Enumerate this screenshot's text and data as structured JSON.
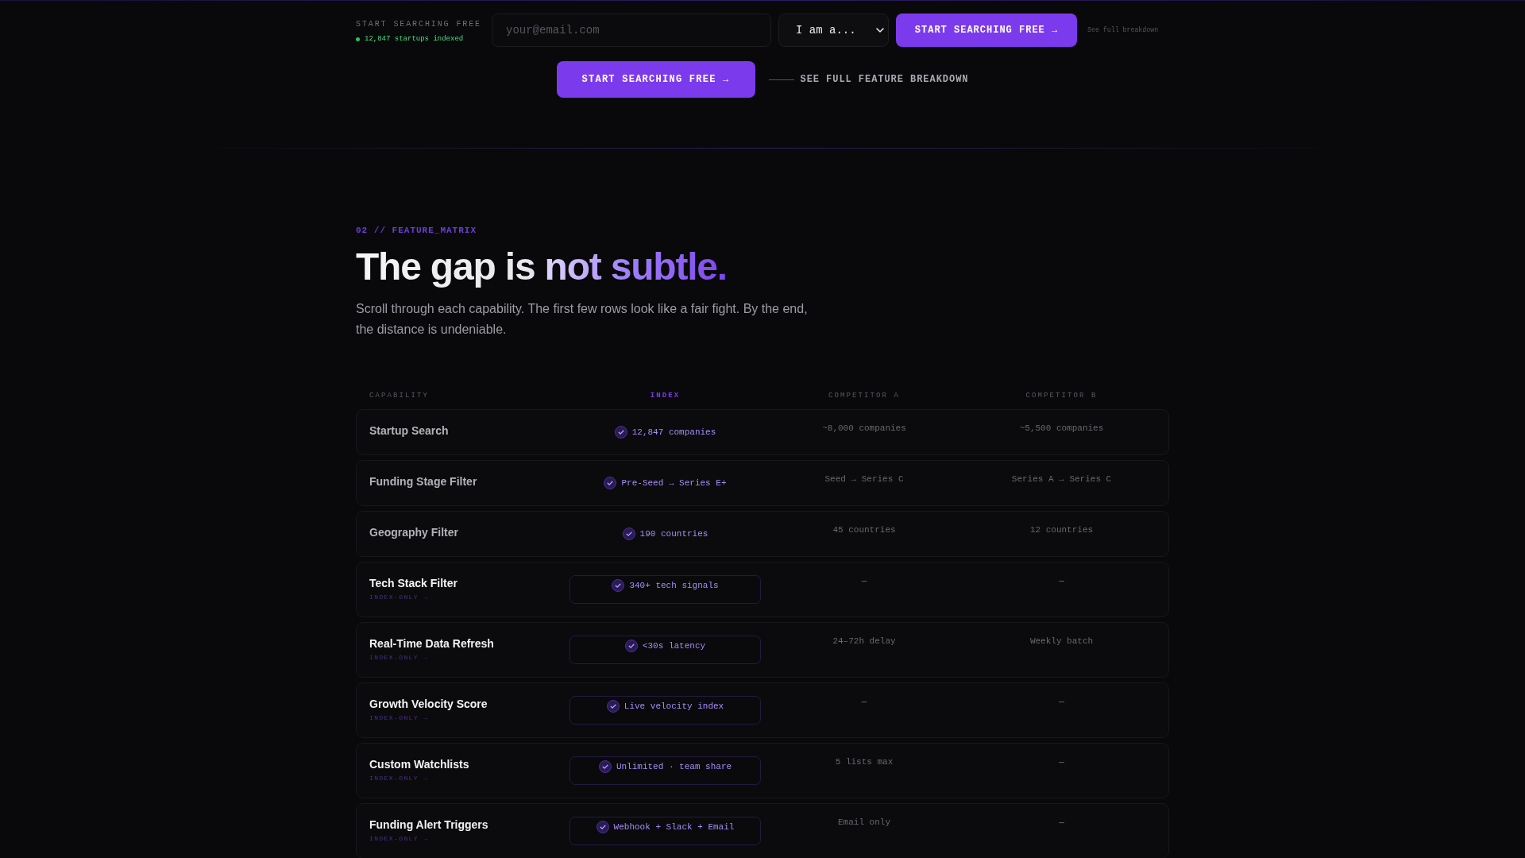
{
  "topbar": {
    "label": "START SEARCHING FREE",
    "status": "12,847 startups indexed",
    "email": {
      "placeholder": "your@email.com"
    },
    "role_select": {
      "value": "I am a..."
    },
    "button": "START SEARCHING FREE →",
    "link": "See full breakdown"
  },
  "hero_cta": {
    "button": "START SEARCHING FREE →",
    "link": "SEE FULL FEATURE BREAKDOWN"
  },
  "section": {
    "eyebrow": "02 // FEATURE_MATRIX",
    "heading": "The gap is not subtle.",
    "intro": "Scroll through each capability. The first few rows look like a fair fight. By the end, the distance is undeniable."
  },
  "table": {
    "columns": [
      {
        "label": "CAPABILITY",
        "highlighted": false
      },
      {
        "label": "INDEX",
        "highlighted": true
      },
      {
        "label": "COMPETITOR A",
        "highlighted": false
      },
      {
        "label": "COMPETITOR B",
        "highlighted": false
      }
    ],
    "rows": [
      {
        "kind": "parity",
        "capability": "Startup Search",
        "index": "12,847 companies",
        "competitor_a": {
          "text": "~8,000 companies",
          "missing": false
        },
        "competitor_b": {
          "text": "~5,500 companies",
          "missing": false
        }
      },
      {
        "kind": "parity",
        "capability": "Funding Stage Filter",
        "index": "Pre-Seed → Series E+",
        "competitor_a": {
          "text": "Seed → Series C",
          "missing": false
        },
        "competitor_b": {
          "text": "Series A → Series C",
          "missing": false
        }
      },
      {
        "kind": "parity",
        "capability": "Geography Filter",
        "index": "190 countries",
        "competitor_a": {
          "text": "45 countries",
          "missing": false
        },
        "competitor_b": {
          "text": "12 countries",
          "missing": false
        }
      },
      {
        "kind": "exclusive",
        "capability": "Tech Stack Filter",
        "tag": "INDEX-ONLY →",
        "index": "340+ tech signals",
        "competitor_a": {
          "text": "—",
          "missing": true
        },
        "competitor_b": {
          "text": "—",
          "missing": true
        }
      },
      {
        "kind": "exclusive",
        "capability": "Real-Time Data Refresh",
        "tag": "INDEX-ONLY →",
        "index": "<30s latency",
        "competitor_a": {
          "text": "24–72h delay",
          "missing": false
        },
        "competitor_b": {
          "text": "Weekly batch",
          "missing": false
        }
      },
      {
        "kind": "exclusive",
        "capability": "Growth Velocity Score",
        "tag": "INDEX-ONLY →",
        "index": "Live velocity index",
        "competitor_a": {
          "text": "—",
          "missing": true
        },
        "competitor_b": {
          "text": "—",
          "missing": true
        }
      },
      {
        "kind": "exclusive",
        "capability": "Custom Watchlists",
        "tag": "INDEX-ONLY →",
        "index": "Unlimited · team share",
        "competitor_a": {
          "text": "5 lists max",
          "missing": false
        },
        "competitor_b": {
          "text": "—",
          "missing": true
        }
      },
      {
        "kind": "exclusive",
        "capability": "Funding Alert Triggers",
        "tag": "INDEX-ONLY →",
        "index": "Webhook + Slack + Email",
        "competitor_a": {
          "text": "Email only",
          "missing": false
        },
        "competitor_b": {
          "text": "—",
          "missing": true
        }
      }
    ]
  }
}
